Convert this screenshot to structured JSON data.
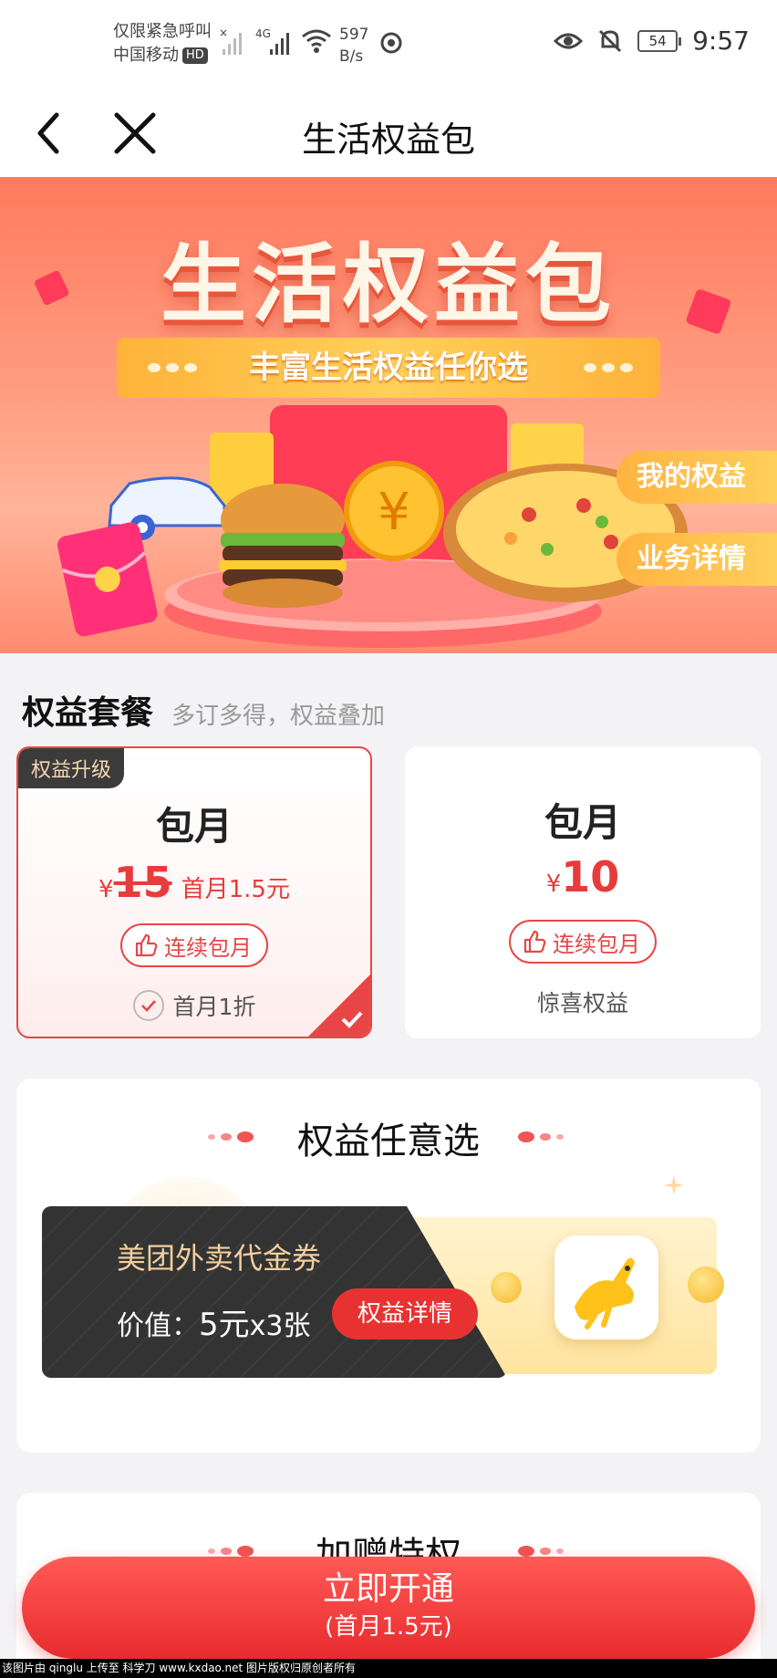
{
  "status_bar": {
    "carrier_line1": "仅限紧急呼叫",
    "carrier_line2": "中国移动",
    "hd_badge": "HD",
    "network": "4G",
    "speed_value": "597",
    "speed_unit": "B/s",
    "battery": "54",
    "time": "9:57"
  },
  "nav": {
    "title": "生活权益包"
  },
  "banner": {
    "headline": "生活权益包",
    "tagline": "丰富生活权益任你选",
    "my_benefits": "我的权益",
    "details": "业务详情"
  },
  "plans_section": {
    "title": "权益套餐",
    "subtitle": "多订多得，权益叠加",
    "plans": [
      {
        "tag": "权益升级",
        "name": "包月",
        "currency": "¥",
        "price": "15",
        "first_month": "首月1.5元",
        "button": "连续包月",
        "note": "首月1折",
        "selected": true
      },
      {
        "name": "包月",
        "currency": "¥",
        "price": "10",
        "button": "连续包月",
        "note": "惊喜权益",
        "selected": false
      }
    ]
  },
  "benefit_section": {
    "title": "权益任意选",
    "voucher_name": "美团外卖代金券",
    "value_label": "价值：",
    "value_amount": "5元",
    "value_count": "x3张",
    "details_button": "权益详情"
  },
  "bonus_section": {
    "title": "加赠特权"
  },
  "cta": {
    "label": "立即开通",
    "sub_label": "(首月1.5元)"
  },
  "footer": {
    "text": "该图片由 qinglu 上传至 科学刀 www.kxdao.net 图片版权归原创者所有"
  },
  "colors": {
    "accent": "#e84646",
    "banner": "#ff8a6e",
    "gold": "#ffc24a"
  }
}
